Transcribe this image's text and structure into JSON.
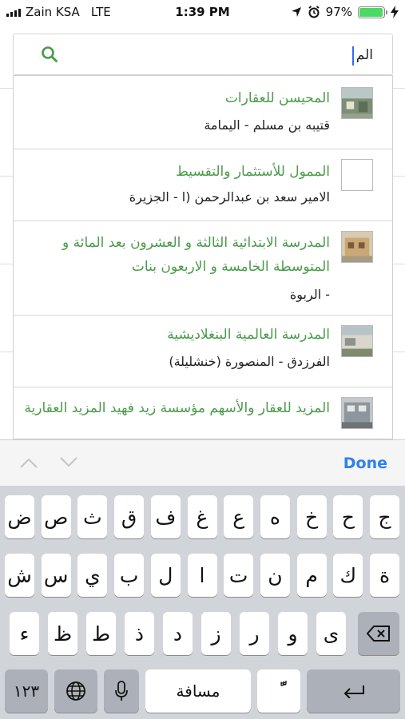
{
  "status": {
    "carrier": "Zain KSA",
    "network": "LTE",
    "time": "1:39 PM",
    "battery_pct": "97%",
    "battery_level": 0.97
  },
  "search": {
    "value": "الم"
  },
  "results": [
    {
      "title": "المحيسن للعقارات",
      "subtitle": "قتيبه بن مسلم   -   اليمامة",
      "has_image": true
    },
    {
      "title": "الممول للأستثمار والتقسيط",
      "subtitle": "الامير سعد بن عبدالرحمن (ا   -   الجزيرة",
      "has_image": false
    },
    {
      "title": "المدرسة الابتدائية الثالثة و العشرون بعد المائة و المتوسطة الخامسة و الاربعون بنات",
      "subtitle": "   -   الربوة",
      "has_image": true
    },
    {
      "title": "المدرسة العالمية البنغلاديشية",
      "subtitle": "الفرزدق   -   المنصورة (خنشليلة)",
      "has_image": true
    },
    {
      "title": "المزيد للعقار والأسهم مؤسسة زيد فهيد المزيد العقارية",
      "subtitle": "",
      "has_image": true
    }
  ],
  "toolbar": {
    "done_label": "Done"
  },
  "keyboard": {
    "row1": [
      "ض",
      "ص",
      "ث",
      "ق",
      "ف",
      "غ",
      "ع",
      "ه",
      "خ",
      "ح",
      "ج"
    ],
    "row2": [
      "ش",
      "س",
      "ي",
      "ب",
      "ل",
      "ا",
      "ت",
      "ن",
      "م",
      "ك",
      "ة"
    ],
    "row3": [
      "ء",
      "ظ",
      "ط",
      "ذ",
      "د",
      "ز",
      "ر",
      "و",
      "ى"
    ],
    "numbers_label": "١٢٣",
    "space_label": "مسافة",
    "diacritic_label": "ًّ"
  }
}
